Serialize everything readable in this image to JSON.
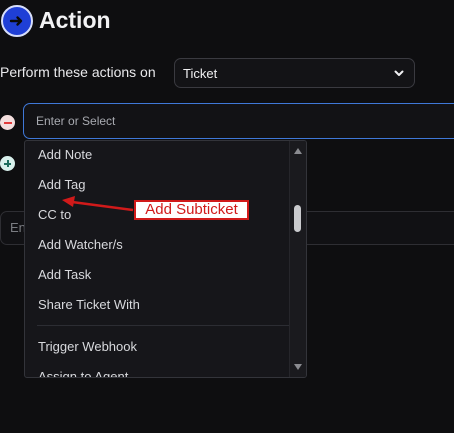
{
  "header": {
    "title": "Action",
    "icon": "arrow-right-icon"
  },
  "perform": {
    "label": "Perform these actions on",
    "selected": "Ticket"
  },
  "action_input": {
    "placeholder": "Enter or Select"
  },
  "background_field": {
    "text": "En"
  },
  "dropdown": {
    "options": [
      "Add Note",
      "Add Tag",
      "CC to",
      "Add Watcher/s",
      "Add Task",
      "Share Ticket With",
      "Trigger Webhook",
      "Assign to Agent"
    ]
  },
  "annotation": {
    "text": "Add Subticket",
    "color": "#d11a1a"
  },
  "colors": {
    "accent_blue": "#1f3fd6",
    "focus_border": "#3f78d8",
    "remove_red": "#e23b3b",
    "add_teal": "#1d6d5e"
  }
}
